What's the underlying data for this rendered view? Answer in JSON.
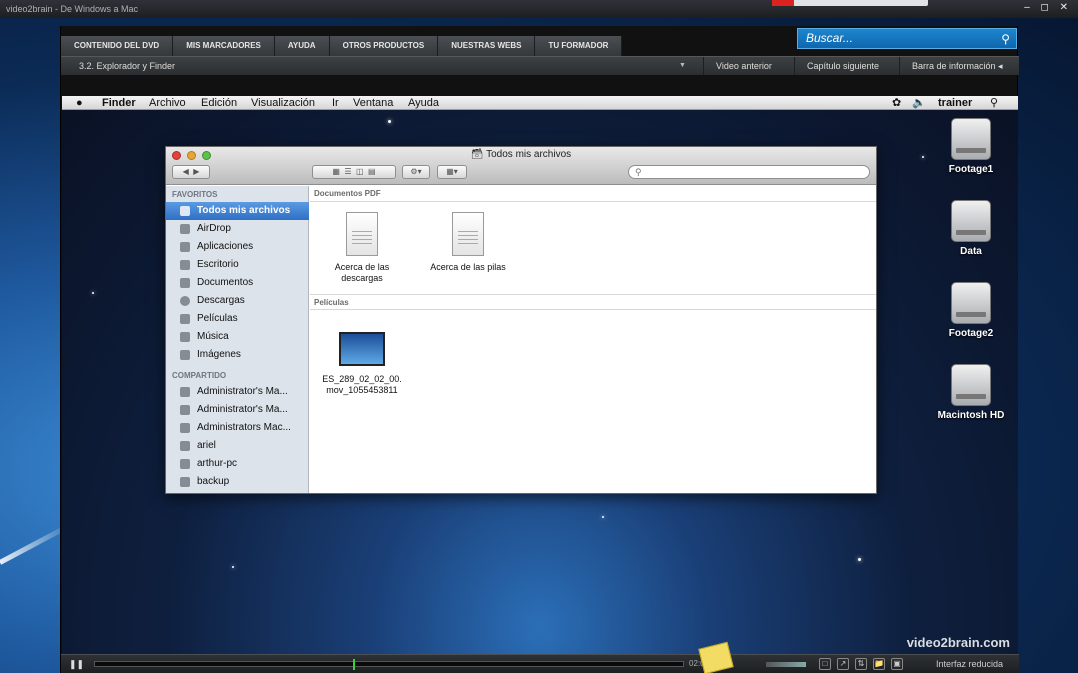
{
  "window": {
    "title": "video2brain - De Windows a Mac",
    "controls": "– ◻ ✕"
  },
  "top_nav": {
    "tabs": [
      "CONTENIDO DEL DVD",
      "MIS MARCADORES",
      "AYUDA",
      "OTROS PRODUCTOS",
      "NUESTRAS WEBS",
      "TU FORMADOR"
    ],
    "search_placeholder": "Buscar...",
    "search_icon": "magnifier-icon"
  },
  "chapter_bar": {
    "current": "3.2.  Explorador y Finder",
    "dropdown_icon": "chevron-down-icon",
    "prev": "Video anterior",
    "next": "Capítulo siguiente",
    "info": "Barra de información"
  },
  "mac": {
    "menubar": {
      "apple": "",
      "app": "Finder",
      "menus": [
        "Archivo",
        "Edición",
        "Visualización",
        "Ir",
        "Ventana",
        "Ayuda"
      ],
      "user": "trainer"
    },
    "desktop_icons": [
      "Footage1",
      "Data",
      "Footage2",
      "Macintosh HD"
    ],
    "finder": {
      "title": "Todos mis archivos",
      "sidebar": {
        "favorites_header": "FAVORITOS",
        "favorites": [
          "Todos mis archivos",
          "AirDrop",
          "Aplicaciones",
          "Escritorio",
          "Documentos",
          "Descargas",
          "Películas",
          "Música",
          "Imágenes"
        ],
        "shared_header": "COMPARTIDO",
        "shared": [
          "Administrator's Ma...",
          "Administrator's Ma...",
          "Administrators Mac...",
          "ariel",
          "arthur-pc",
          "backup"
        ]
      },
      "sections": [
        {
          "header": "Documentos PDF",
          "files": [
            [
              "Acerca de las",
              "descargas"
            ],
            [
              "Acerca de las pilas",
              ""
            ]
          ]
        },
        {
          "header": "Películas",
          "files": [
            [
              "ES_289_02_02_00.",
              "mov_1055453811"
            ]
          ]
        }
      ]
    },
    "watermark": "video2brain.com"
  },
  "controls": {
    "play_icon": "pause-icon",
    "progress_fraction": 0.44,
    "timecode": "02:00:00",
    "reduced": "Interfaz reducida"
  },
  "colors": {
    "accent": "#1c86cf",
    "selection": "#2f6fc4",
    "progress_marker": "#3bd13b"
  }
}
